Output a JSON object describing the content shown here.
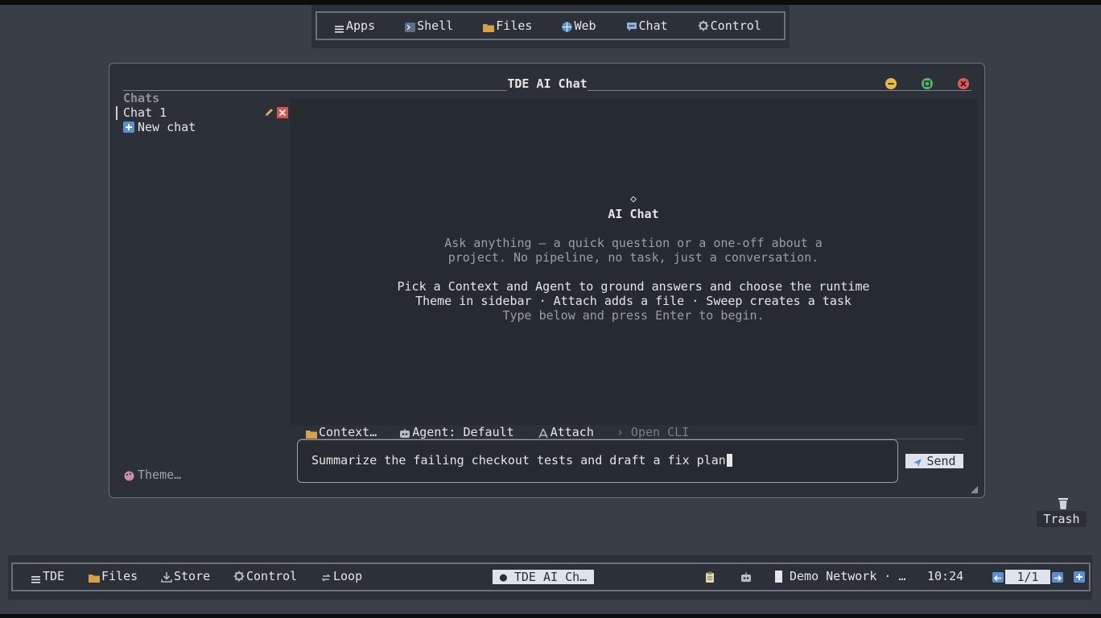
{
  "top_menu": {
    "items": [
      {
        "label": "Apps",
        "icon": "list-icon"
      },
      {
        "label": "Shell",
        "icon": "terminal-icon"
      },
      {
        "label": "Files",
        "icon": "folder-icon"
      },
      {
        "label": "Web",
        "icon": "globe-icon"
      },
      {
        "label": "Chat",
        "icon": "chat-bubble-icon"
      },
      {
        "label": "Control",
        "icon": "gear-icon"
      }
    ]
  },
  "window": {
    "title": "TDE AI Chat",
    "controls": {
      "minimize": "minimize",
      "maximize": "maximize",
      "close": "close"
    }
  },
  "sidebar": {
    "heading": "Chats",
    "chats": [
      {
        "label": "Chat 1"
      }
    ],
    "new_chat_label": "New chat",
    "theme_label": "Theme…"
  },
  "welcome": {
    "glyph": "◇",
    "title": "AI Chat",
    "intro_line1": "Ask anything — a quick question or a one-off about a",
    "intro_line2": "project. No pipeline, no task, just a conversation.",
    "tips_line1": "Pick a Context and Agent to ground answers and choose the runtime",
    "tips_line2": "Theme in sidebar · Attach adds a file · Sweep creates a task",
    "hint": "Type below and press Enter to begin."
  },
  "composer": {
    "context_label": "Context…",
    "agent_label": "Agent: Default",
    "attach_label": "Attach",
    "open_cli_label": "› Open CLI",
    "input_value": "Summarize the failing checkout tests and draft a fix plan",
    "send_label": "Send"
  },
  "desktop": {
    "trash_label": "Trash"
  },
  "taskbar": {
    "items": [
      {
        "label": "TDE",
        "icon": "list-icon"
      },
      {
        "label": "Files",
        "icon": "folder-icon"
      },
      {
        "label": "Store",
        "icon": "download-icon"
      },
      {
        "label": "Control",
        "icon": "gear-icon"
      },
      {
        "label": "Loop",
        "icon": "loop-icon"
      }
    ],
    "active_window": "● TDE AI Ch…",
    "network_label": "Demo Network · …",
    "clock": "10:24",
    "pager": "1/1"
  },
  "colors": {
    "background": "#3a3f47",
    "panel": "#2c3038",
    "chat_area": "#262a31",
    "minimize": "#e8b84a",
    "maximize": "#5fae6e",
    "close": "#e05a5a",
    "accent_blue": "#5b8fd0"
  }
}
